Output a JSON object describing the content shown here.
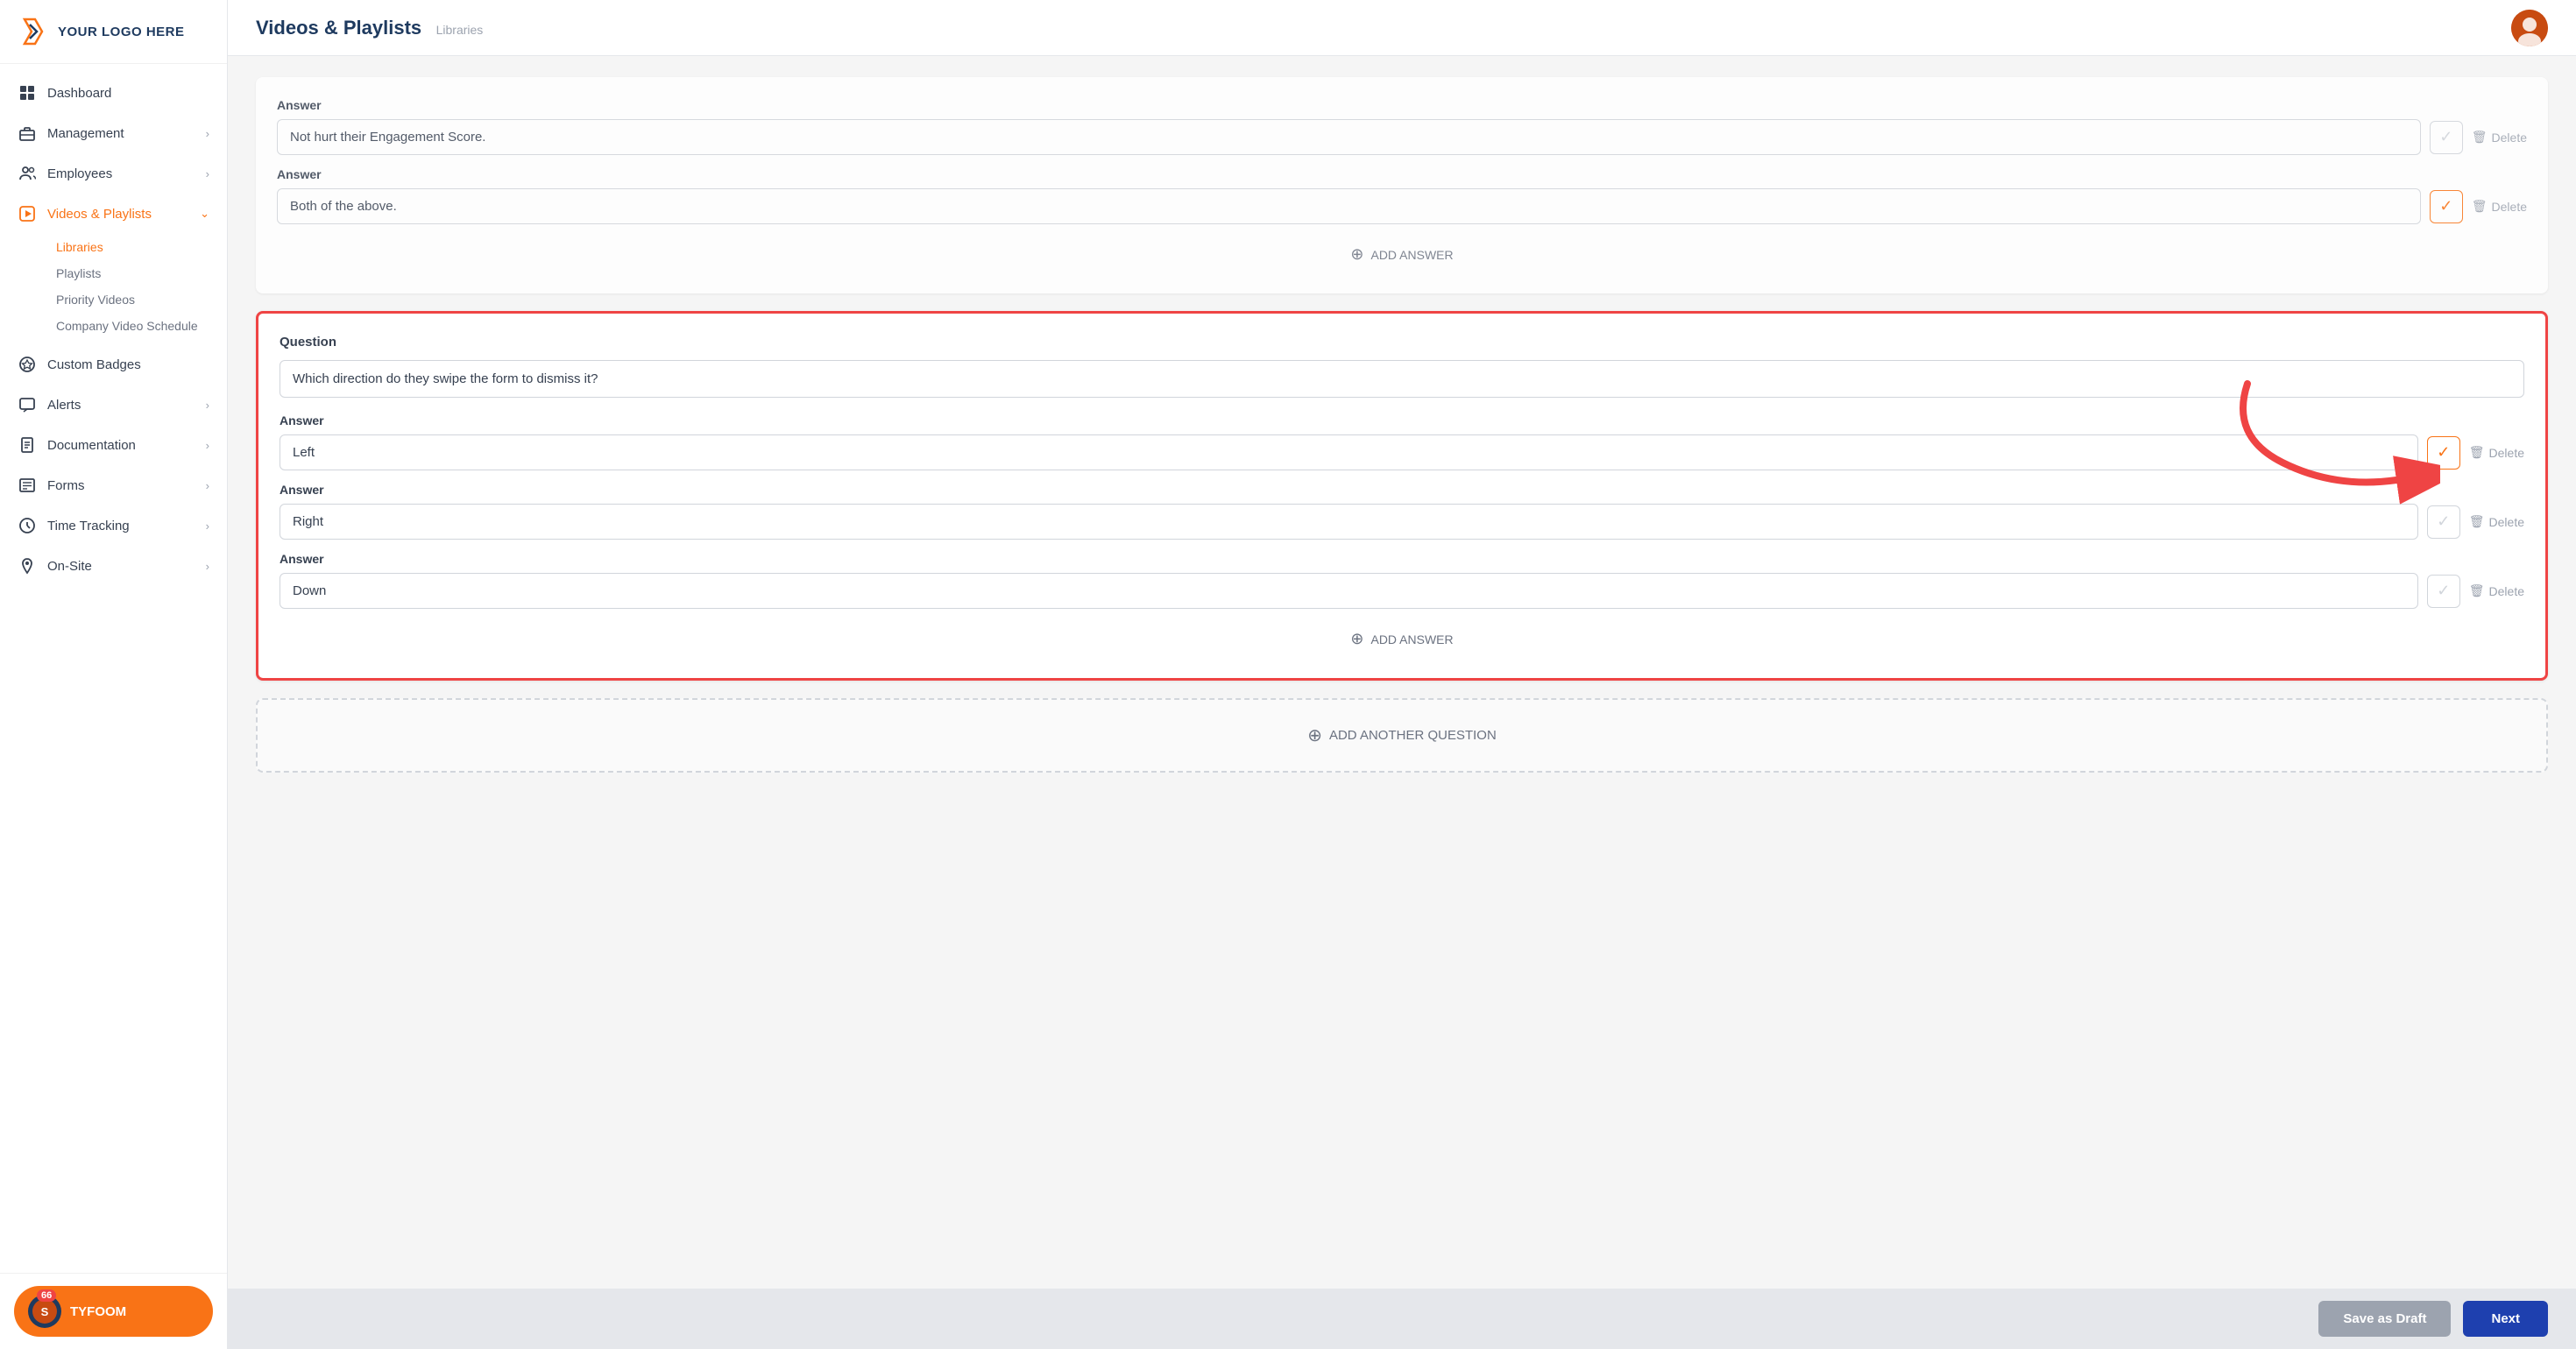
{
  "app": {
    "logo_text": "YOUR LOGO HERE",
    "page_title": "Videos & Playlists",
    "page_subtitle": "Libraries"
  },
  "sidebar": {
    "items": [
      {
        "id": "dashboard",
        "label": "Dashboard",
        "icon": "grid-icon",
        "has_chevron": false
      },
      {
        "id": "management",
        "label": "Management",
        "icon": "briefcase-icon",
        "has_chevron": true
      },
      {
        "id": "employees",
        "label": "Employees",
        "icon": "users-icon",
        "has_chevron": true
      },
      {
        "id": "videos-playlists",
        "label": "Videos & Playlists",
        "icon": "play-icon",
        "has_chevron": true,
        "active": true
      },
      {
        "id": "custom-badges",
        "label": "Custom Badges",
        "icon": "badge-icon",
        "has_chevron": false
      },
      {
        "id": "alerts",
        "label": "Alerts",
        "icon": "chat-icon",
        "has_chevron": true
      },
      {
        "id": "documentation",
        "label": "Documentation",
        "icon": "doc-icon",
        "has_chevron": true
      },
      {
        "id": "forms",
        "label": "Forms",
        "icon": "list-icon",
        "has_chevron": true
      },
      {
        "id": "time-tracking",
        "label": "Time Tracking",
        "icon": "clock-icon",
        "has_chevron": true
      },
      {
        "id": "on-site",
        "label": "On-Site",
        "icon": "location-icon",
        "has_chevron": true
      }
    ],
    "sub_items": [
      {
        "label": "Libraries",
        "active": true
      },
      {
        "label": "Playlists",
        "active": false
      },
      {
        "label": "Priority Videos",
        "active": false
      },
      {
        "label": "Company Video Schedule",
        "active": false
      }
    ],
    "tyfoom": {
      "label": "TYFOOM",
      "badge": "66"
    }
  },
  "partial_card": {
    "answer1_label": "Answer",
    "answer1_value": "Not hurt their Engagement Score.",
    "answer2_label": "Answer",
    "answer2_value": "Both of the above.",
    "add_answer": "ADD ANSWER"
  },
  "highlighted_card": {
    "question_label": "Question",
    "question_value": "Which direction do they swipe the form to dismiss it?",
    "answers": [
      {
        "label": "Answer",
        "value": "Left",
        "correct": true
      },
      {
        "label": "Answer",
        "value": "Right",
        "correct": false
      },
      {
        "label": "Answer",
        "value": "Down",
        "correct": false
      }
    ],
    "add_answer": "ADD ANSWER",
    "delete_label": "Delete"
  },
  "add_question": {
    "label": "ADD ANOTHER QUESTION"
  },
  "footer": {
    "save_draft": "Save as Draft",
    "next": "Next"
  },
  "icons": {
    "circle_plus": "⊕",
    "trash": "🗑",
    "check": "✓",
    "chevron_right": "›",
    "chevron_down": "⌄"
  }
}
